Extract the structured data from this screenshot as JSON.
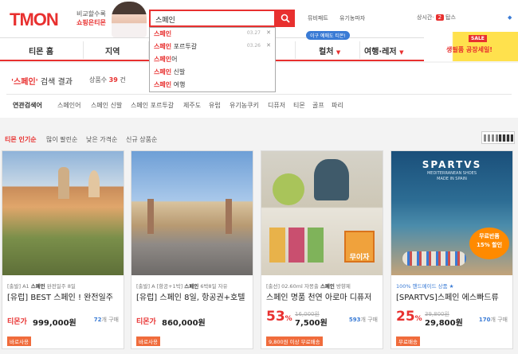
{
  "header": {
    "logo": "TMON",
    "promo_line1": "비교할수록",
    "promo_line2": "쇼핑은티몬",
    "search_value": "스페인",
    "top_links": [
      "뮤비패트",
      "유기농파자"
    ],
    "login_label": "상시간",
    "cart_count": "2",
    "cart_label": "탑스"
  },
  "nav": {
    "items": [
      "티몬 홈",
      "지역",
      "컬처",
      "여행·레저"
    ],
    "daily_badge": "이구 예매도 티몬!",
    "sale_tag": "SALE",
    "sale_text": "생필품 공장세일!"
  },
  "autocomplete": [
    {
      "hl": "스페인",
      "rest": "",
      "date": "03.27"
    },
    {
      "hl": "스페인",
      "rest": " 포르투갈",
      "date": "03.26"
    },
    {
      "hl": "스페인",
      "rest": "어",
      "date": ""
    },
    {
      "hl": "스페인",
      "rest": " 신발",
      "date": ""
    },
    {
      "hl": "스페인",
      "rest": " 여행",
      "date": ""
    }
  ],
  "results": {
    "query": "'스페인'",
    "title_suffix": " 검색 결과",
    "count_prefix": "상품수",
    "count": "39",
    "count_unit": "건",
    "related_label": "연관검색어",
    "related": [
      "스페인어",
      "스페인 신발",
      "스페인 포르투갈",
      "제주도",
      "유럽",
      "유기농쿠키",
      "디퓨저",
      "티몬",
      "골프",
      "파리"
    ]
  },
  "sort": [
    "티몬 인기순",
    "많이 팔린순",
    "낮은 가격순",
    "신규 상품순"
  ],
  "cards": [
    {
      "sub_pre": "[출발] A1",
      "sub_bold": "스페인",
      "sub_post": " 완전일주 8일",
      "title": "[유럽] BEST 스페인 ! 완전일주",
      "price_label": "티몬가",
      "price": "999,000원",
      "sales": "72",
      "sales_unit": "개 구매",
      "tag": "바로사용"
    },
    {
      "sub_pre": "[출발] A [항공+1박]",
      "sub_bold": "스페인",
      "sub_post": " 6박8일 자유",
      "title": "[유럽] 스페인 8일, 항공권+호텔",
      "price_label": "티몬가",
      "price": "860,000원",
      "sales": "",
      "sales_unit": "",
      "tag": "바로사용"
    },
    {
      "sub_pre": "[출선] 02.60ml 자몽출",
      "sub_bold": "스페인",
      "sub_post": " 방향제",
      "title": "스페인 명품 천연 아로마 디퓨저",
      "disc": "53",
      "orig": "16,000원",
      "price": "7,500원",
      "sales": "593",
      "sales_unit": "개 구매",
      "tag": "9,800원 이상 무료배송",
      "overlay": "무이자"
    },
    {
      "sub_pre": "100% 핸드메이드 상품 ★",
      "sub_bold": "",
      "sub_post": "",
      "title": "[SPARTVS]스페인 에스빠드류",
      "disc": "25",
      "orig": "39,800원",
      "price": "29,800원",
      "sales": "170",
      "sales_unit": "개 구매",
      "tag": "무료배송",
      "brand": "SPARTVS",
      "brand_sub": "MEDITERRANEAN SHOES",
      "brand_sub2": "MADE IN SPAIN",
      "badge1": "무료반품",
      "badge2": "15% 할인"
    }
  ]
}
